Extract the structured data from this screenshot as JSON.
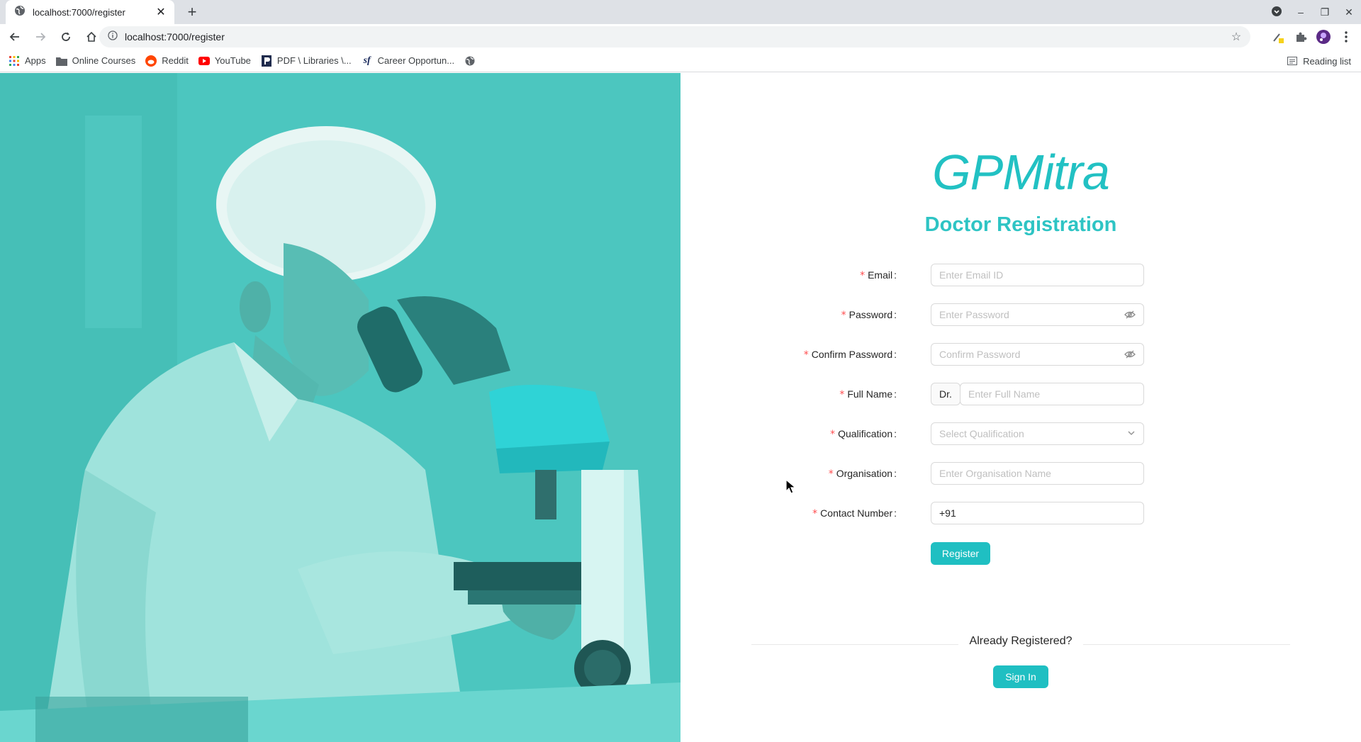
{
  "browser": {
    "tab_title": "localhost:7000/register",
    "url": "localhost:7000/register",
    "bookmarks": [
      "Apps",
      "Online Courses",
      "Reddit",
      "YouTube",
      "PDF \\ Libraries \\...",
      "Career Opportun..."
    ],
    "reading_list": "Reading list"
  },
  "brand": "GPMitra",
  "title": "Doctor Registration",
  "form": {
    "email": {
      "label": "Email",
      "placeholder": "Enter Email ID"
    },
    "password": {
      "label": "Password",
      "placeholder": "Enter Password"
    },
    "confirm": {
      "label": "Confirm Password",
      "placeholder": "Confirm Password"
    },
    "fullname": {
      "label": "Full Name",
      "prefix": "Dr.",
      "placeholder": "Enter Full Name"
    },
    "qualification": {
      "label": "Qualification",
      "placeholder": "Select Qualification"
    },
    "organisation": {
      "label": "Organisation",
      "placeholder": "Enter Organisation Name"
    },
    "contact": {
      "label": "Contact Number",
      "value": "+91"
    },
    "register_label": "Register"
  },
  "signin": {
    "prompt": "Already Registered?",
    "button": "Sign In"
  },
  "colors": {
    "accent": "#1fbfc2",
    "hero": "#47c4bd"
  }
}
